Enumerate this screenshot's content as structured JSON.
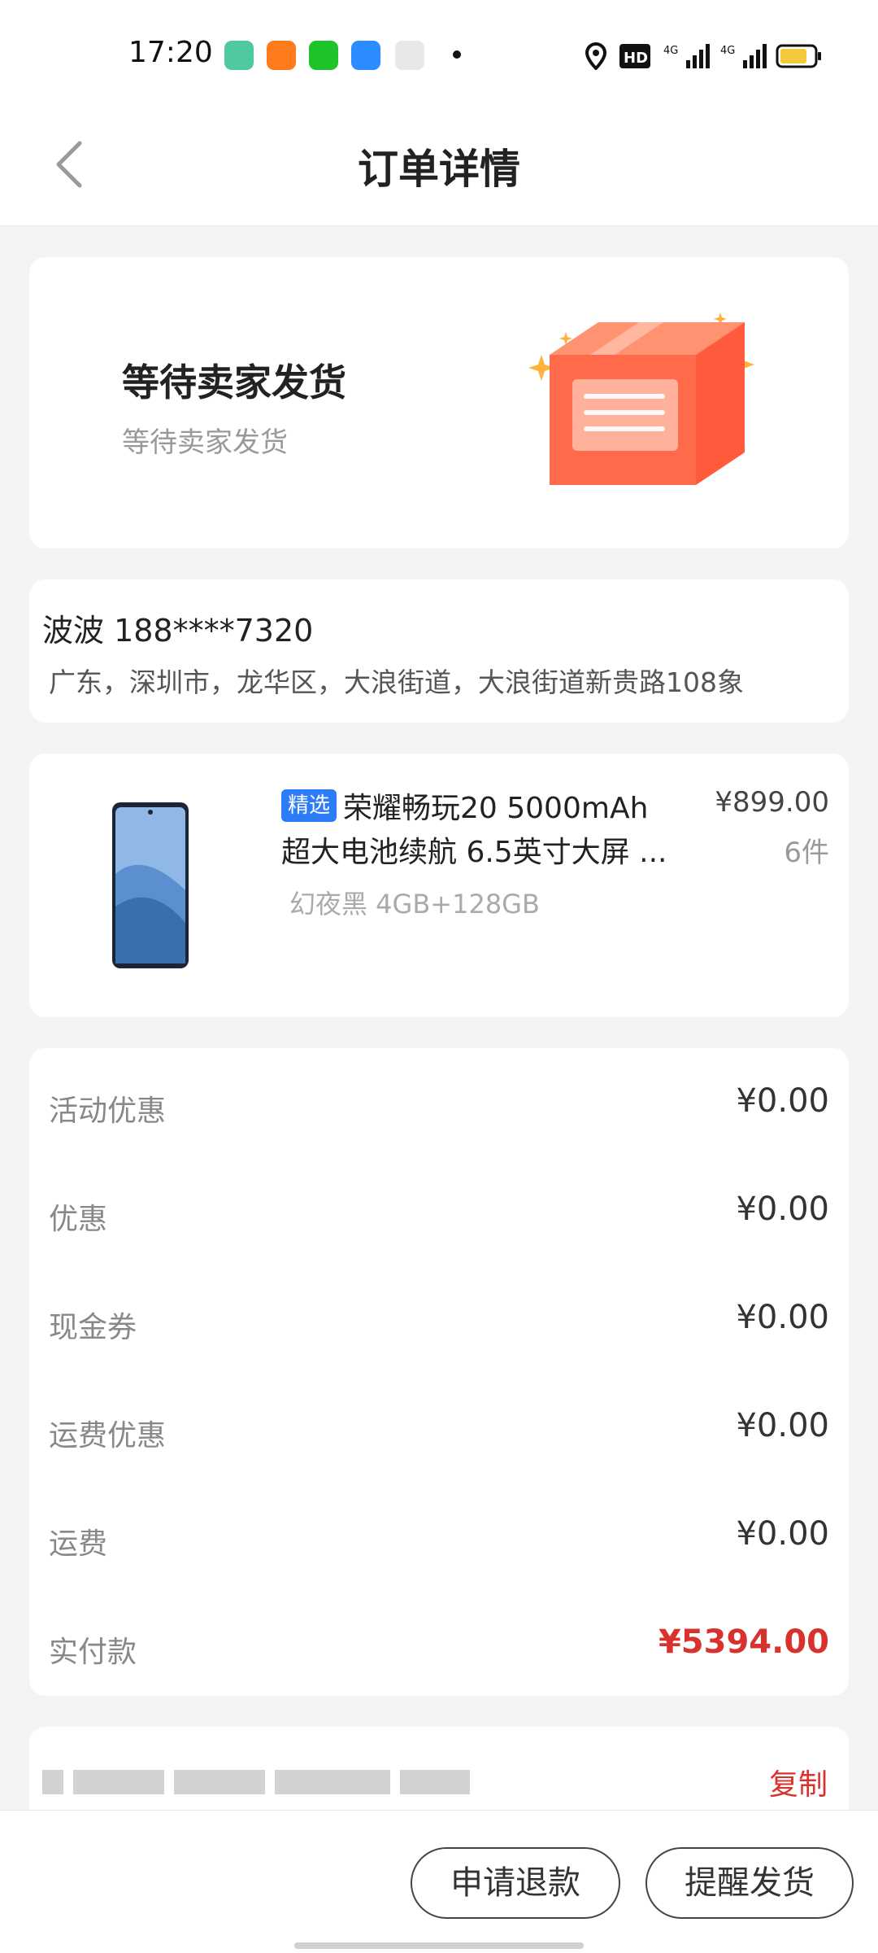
{
  "status_bar": {
    "time": "17:20",
    "icons": [
      "app-icon",
      "58-app-icon",
      "iqiyi-icon",
      "youku-icon",
      "map-app-icon",
      "location-icon",
      "hd-icon",
      "4g-signal-icon",
      "4g-signal-icon",
      "battery-icon"
    ]
  },
  "header": {
    "title": "订单详情"
  },
  "order_status": {
    "title": "等待卖家发货",
    "subtitle": "等待卖家发货"
  },
  "address": {
    "name_phone": "波波 188****7320",
    "line": "广东，深圳市，龙华区，大浪街道，大浪街道新贵路108象"
  },
  "product": {
    "tag": "精选",
    "name_line1": "荣耀畅玩20 5000mAh",
    "name_line2": "超大电池续航 6.5英寸大屏 ...",
    "spec": "幻夜黑 4GB+128GB",
    "price": "¥899.00",
    "quantity": "6件"
  },
  "fees": [
    {
      "label": "活动优惠",
      "value": "¥0.00"
    },
    {
      "label": "优惠",
      "value": "¥0.00"
    },
    {
      "label": "现金券",
      "value": "¥0.00"
    },
    {
      "label": "运费优惠",
      "value": "¥0.00"
    },
    {
      "label": "运费",
      "value": "¥0.00"
    },
    {
      "label": "实付款",
      "value": "¥5394.00"
    }
  ],
  "order_number": {
    "copy_label": "复制"
  },
  "actions": {
    "refund": "申请退款",
    "remind": "提醒发货"
  },
  "colors": {
    "accent_red": "#d9312e",
    "tag_blue": "#2b7cf6",
    "box_orange": "#ff6b4a"
  }
}
